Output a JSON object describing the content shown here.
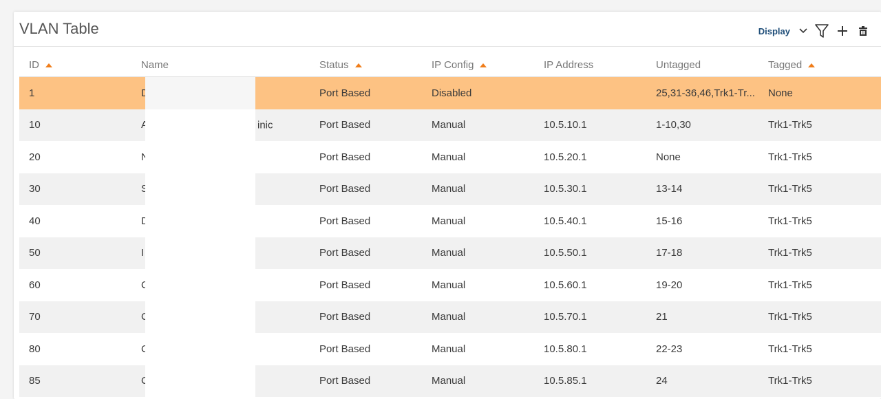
{
  "header": {
    "title": "VLAN Table",
    "display_label": "Display"
  },
  "toolbar_icons": [
    "chevron-down-icon",
    "filter-icon",
    "plus-icon",
    "trash-icon"
  ],
  "colors": {
    "accent": "#f07d1a",
    "selected_row": "#fdc283",
    "display_link": "#1f4e79"
  },
  "table": {
    "columns": [
      {
        "label": "ID",
        "sorted": true
      },
      {
        "label": "Name",
        "sorted": false
      },
      {
        "label": "Status",
        "sorted": true
      },
      {
        "label": "IP Config",
        "sorted": true
      },
      {
        "label": "IP Address",
        "sorted": false
      },
      {
        "label": "Untagged",
        "sorted": false
      },
      {
        "label": "Tagged",
        "sorted": true
      }
    ],
    "rows": [
      {
        "id": "1",
        "name": "D",
        "name_suffix": "",
        "status": "Port Based",
        "ip_config": "Disabled",
        "ip_address": "",
        "untagged": "25,31-36,46,Trk1-Tr...",
        "tagged": "None"
      },
      {
        "id": "10",
        "name": "A",
        "name_suffix": "inic",
        "status": "Port Based",
        "ip_config": "Manual",
        "ip_address": "10.5.10.1",
        "untagged": "1-10,30",
        "tagged": "Trk1-Trk5"
      },
      {
        "id": "20",
        "name": "N",
        "name_suffix": "",
        "status": "Port Based",
        "ip_config": "Manual",
        "ip_address": "10.5.20.1",
        "untagged": "None",
        "tagged": "Trk1-Trk5"
      },
      {
        "id": "30",
        "name": "S",
        "name_suffix": "",
        "status": "Port Based",
        "ip_config": "Manual",
        "ip_address": "10.5.30.1",
        "untagged": "13-14",
        "tagged": "Trk1-Trk5"
      },
      {
        "id": "40",
        "name": "D",
        "name_suffix": "",
        "status": "Port Based",
        "ip_config": "Manual",
        "ip_address": "10.5.40.1",
        "untagged": "15-16",
        "tagged": "Trk1-Trk5"
      },
      {
        "id": "50",
        "name": "I",
        "name_suffix": "",
        "status": "Port Based",
        "ip_config": "Manual",
        "ip_address": "10.5.50.1",
        "untagged": "17-18",
        "tagged": "Trk1-Trk5"
      },
      {
        "id": "60",
        "name": "C",
        "name_suffix": "",
        "status": "Port Based",
        "ip_config": "Manual",
        "ip_address": "10.5.60.1",
        "untagged": "19-20",
        "tagged": "Trk1-Trk5"
      },
      {
        "id": "70",
        "name": "C",
        "name_suffix": "",
        "status": "Port Based",
        "ip_config": "Manual",
        "ip_address": "10.5.70.1",
        "untagged": "21",
        "tagged": "Trk1-Trk5"
      },
      {
        "id": "80",
        "name": "C",
        "name_suffix": "",
        "status": "Port Based",
        "ip_config": "Manual",
        "ip_address": "10.5.80.1",
        "untagged": "22-23",
        "tagged": "Trk1-Trk5"
      },
      {
        "id": "85",
        "name": "C",
        "name_suffix": "",
        "status": "Port Based",
        "ip_config": "Manual",
        "ip_address": "10.5.85.1",
        "untagged": "24",
        "tagged": "Trk1-Trk5"
      }
    ]
  }
}
